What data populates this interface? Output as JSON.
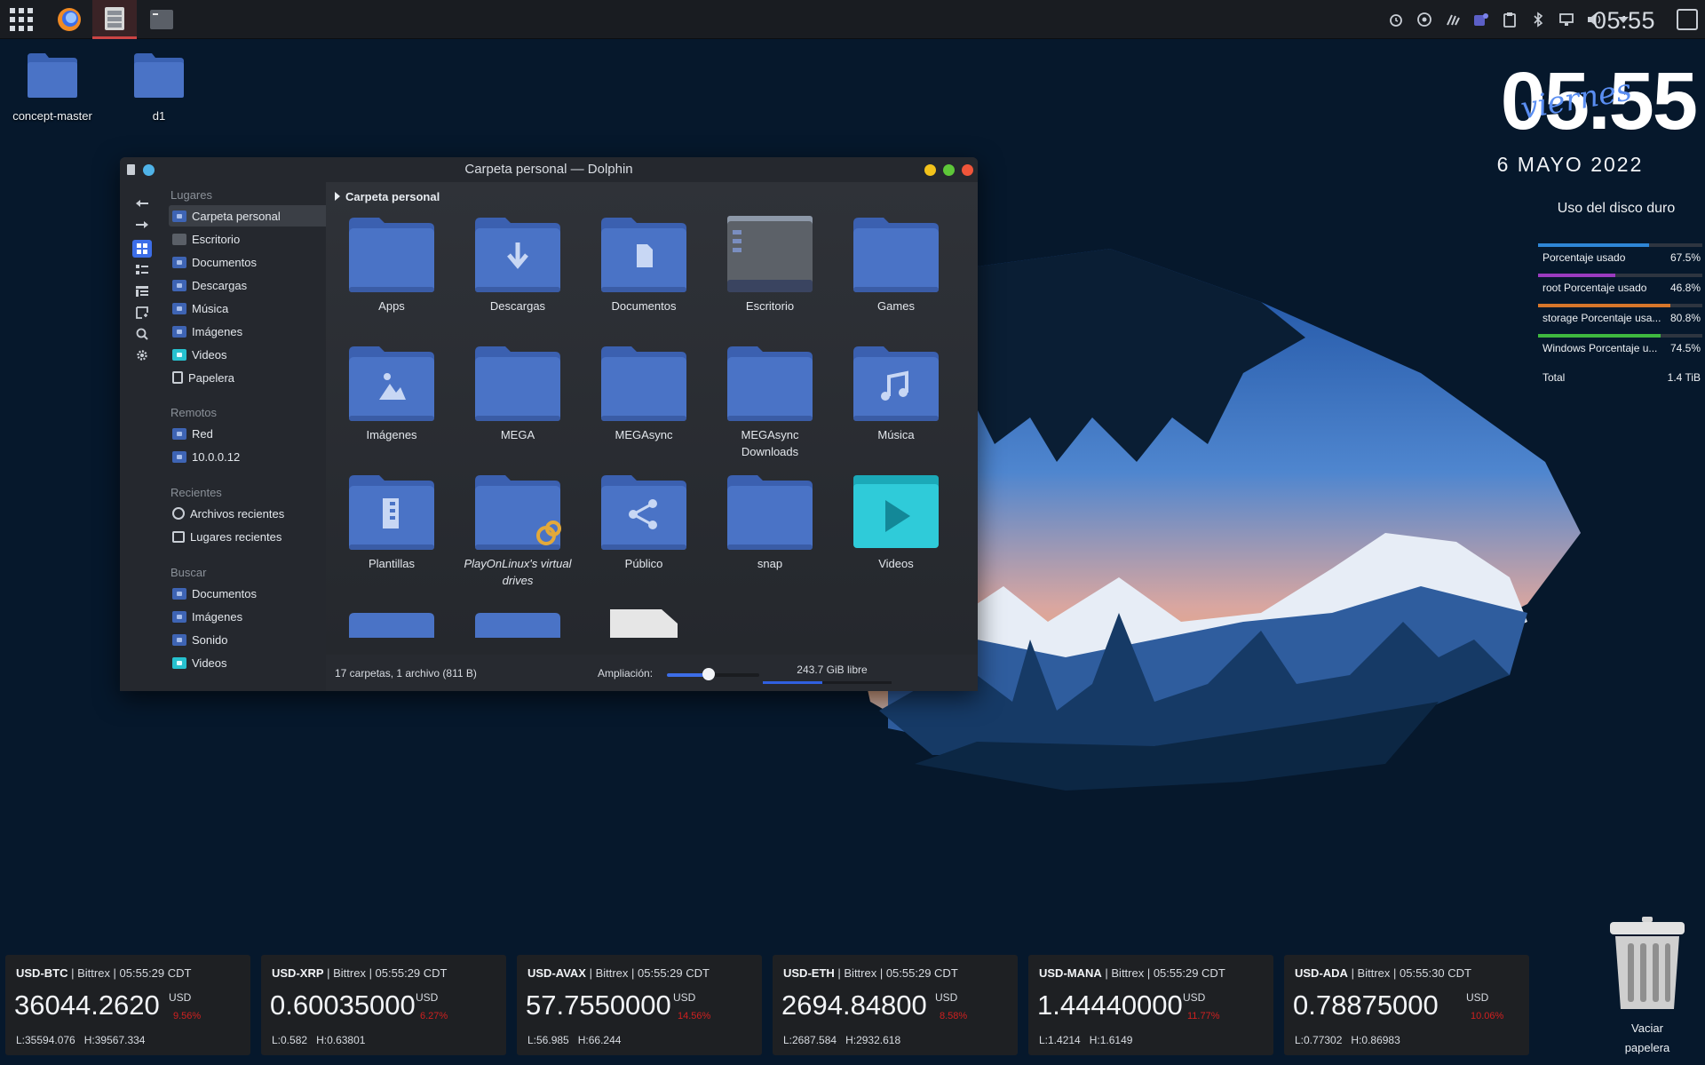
{
  "panel": {
    "clock": "05:55",
    "tasks": [
      "application-launcher",
      "firefox",
      "dolphin",
      "konsole"
    ],
    "tray_icons": [
      "alarm-icon",
      "updates-icon",
      "kdeconnect-icon",
      "teams-icon",
      "clipboard-icon",
      "bluetooth-icon",
      "display-icon",
      "volume-icon",
      "expand-tray-icon"
    ]
  },
  "desktop": {
    "icons": [
      {
        "label": "concept-master",
        "icon": "folder-icon"
      },
      {
        "label": "d1",
        "icon": "folder-icon"
      }
    ]
  },
  "dolphin": {
    "title": "Carpeta personal — Dolphin",
    "breadcrumb": "Carpeta personal",
    "sections": {
      "places": "Lugares",
      "remote": "Remotos",
      "recent": "Recientes",
      "search": "Buscar"
    },
    "places": [
      {
        "label": "Carpeta personal",
        "selected": true
      },
      {
        "label": "Escritorio"
      },
      {
        "label": "Documentos"
      },
      {
        "label": "Descargas"
      },
      {
        "label": "Música"
      },
      {
        "label": "Imágenes"
      },
      {
        "label": "Videos"
      },
      {
        "label": "Papelera"
      }
    ],
    "remote": [
      {
        "label": "Red"
      },
      {
        "label": "10.0.0.12"
      }
    ],
    "recent": [
      {
        "label": "Archivos recientes"
      },
      {
        "label": "Lugares recientes"
      }
    ],
    "search": [
      {
        "label": "Documentos"
      },
      {
        "label": "Imágenes"
      },
      {
        "label": "Sonido"
      },
      {
        "label": "Videos"
      }
    ],
    "files": [
      {
        "label": "Apps",
        "icon": "folder-icon"
      },
      {
        "label": "Descargas",
        "icon": "folder-download-icon"
      },
      {
        "label": "Documentos",
        "icon": "folder-documents-icon"
      },
      {
        "label": "Escritorio",
        "icon": "folder-desktop-icon"
      },
      {
        "label": "Games",
        "icon": "folder-icon"
      },
      {
        "label": "Imágenes",
        "icon": "folder-pictures-icon"
      },
      {
        "label": "MEGA",
        "icon": "folder-icon"
      },
      {
        "label": "MEGAsync",
        "icon": "folder-icon"
      },
      {
        "label": "MEGAsync Downloads",
        "icon": "folder-icon"
      },
      {
        "label": "Música",
        "icon": "folder-music-icon"
      },
      {
        "label": "Plantillas",
        "icon": "folder-templates-icon"
      },
      {
        "label": "PlayOnLinux's virtual drives",
        "icon": "folder-link-icon",
        "italic": true
      },
      {
        "label": "Público",
        "icon": "folder-public-icon"
      },
      {
        "label": "snap",
        "icon": "folder-icon"
      },
      {
        "label": "Videos",
        "icon": "folder-videos-icon"
      }
    ],
    "status": "17 carpetas, 1 archivo (811 B)",
    "zoom_label": "Ampliación:",
    "zoom_level": 0.45,
    "free_space": "243.7 GiB libre",
    "used_fraction": 0.46
  },
  "clock_widget": {
    "time": "05.55",
    "weekday": "viernes",
    "date": "6 MAYO 2022"
  },
  "disk_widget": {
    "title": "Uso del disco duro",
    "rows": [
      {
        "label": "Porcentaje usado",
        "value": "67.5%",
        "fraction": 0.675,
        "color": "#2f86d6"
      },
      {
        "label": "root Porcentaje usado",
        "value": "46.8%",
        "fraction": 0.468,
        "color": "#9b3bbf"
      },
      {
        "label": "storage Porcentaje usa...",
        "value": "80.8%",
        "fraction": 0.808,
        "color": "#d7762a"
      },
      {
        "label": "Windows Porcentaje u...",
        "value": "74.5%",
        "fraction": 0.745,
        "color": "#3fb83f"
      }
    ],
    "total_label": "Total",
    "total_value": "1.4 TiB"
  },
  "tickers": [
    {
      "pair": "USD-BTC",
      "info": " | Bittrex | 05:55:29 CDT",
      "price": "36044.2620",
      "currency": "USD",
      "change": "9.56%",
      "low": "L:35594.076",
      "high": "H:39567.334"
    },
    {
      "pair": "USD-XRP",
      "info": " | Bittrex | 05:55:29 CDT",
      "price": "0.60035000",
      "currency": "USD",
      "change": "6.27%",
      "low": "L:0.582",
      "high": "H:0.63801"
    },
    {
      "pair": "USD-AVAX",
      "info": " | Bittrex | 05:55:29 CDT",
      "price": "57.7550000",
      "currency": "USD",
      "change": "14.56%",
      "low": "L:56.985",
      "high": "H:66.244"
    },
    {
      "pair": "USD-ETH",
      "info": " | Bittrex | 05:55:29 CDT",
      "price": "2694.84800",
      "currency": "USD",
      "change": "8.58%",
      "low": "L:2687.584",
      "high": "H:2932.618"
    },
    {
      "pair": "USD-MANA",
      "info": " | Bittrex | 05:55:29 CDT",
      "price": "1.44440000",
      "currency": "USD",
      "change": "11.77%",
      "low": "L:1.4214",
      "high": "H:1.6149"
    },
    {
      "pair": "USD-ADA",
      "info": " | Bittrex | 05:55:30 CDT",
      "price": "0.78875000",
      "currency": "USD",
      "change": "10.06%",
      "low": "L:0.77302",
      "high": "H:0.86983"
    }
  ],
  "trash": {
    "label_line1": "Vaciar",
    "label_line2": "papelera"
  },
  "colors": {
    "panel": "#191c21",
    "accent": "#3d6ee8",
    "folder": "#4a73c6",
    "negative": "#d02020"
  }
}
